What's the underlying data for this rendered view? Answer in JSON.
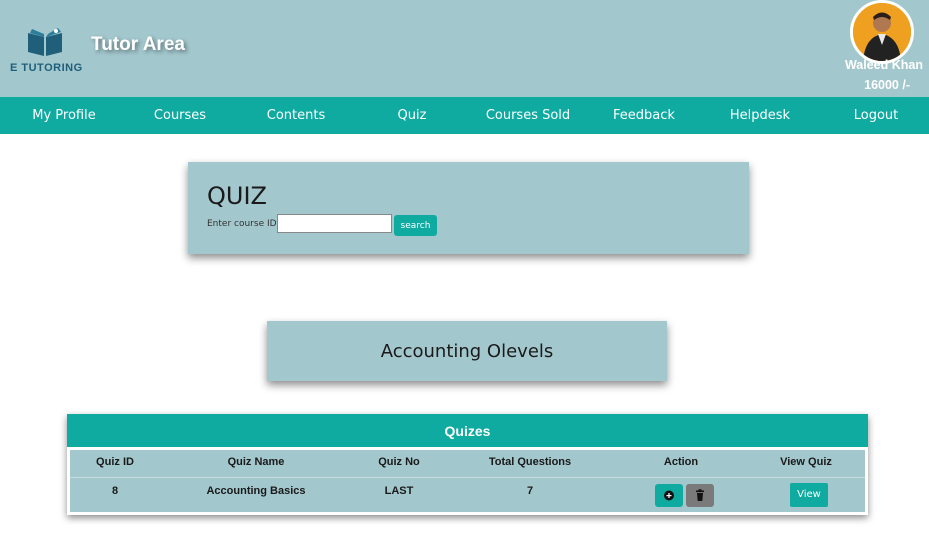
{
  "header": {
    "logo_text": "E TUTORING",
    "app_title": "Tutor Area",
    "user_name": "Waleed Khan",
    "user_balance": "16000 /-",
    "bg_color": "#a2c7cd"
  },
  "nav": {
    "bg_color": "#0faaa0",
    "items": [
      {
        "label": "My Profile"
      },
      {
        "label": "Courses"
      },
      {
        "label": "Contents"
      },
      {
        "label": "Quiz"
      },
      {
        "label": "Courses Sold"
      },
      {
        "label": "Feedback"
      },
      {
        "label": "Helpdesk"
      },
      {
        "label": "Logout"
      }
    ]
  },
  "quiz_search": {
    "title": "QUIZ",
    "label": "Enter course ID:",
    "input_value": "",
    "button_label": "search"
  },
  "course": {
    "name": "Accounting Olevels"
  },
  "quizzes_table": {
    "title": "Quizes",
    "columns": [
      "Quiz ID",
      "Quiz Name",
      "Quiz No",
      "Total Questions",
      "Action",
      "View Quiz"
    ],
    "rows": [
      {
        "quiz_id": "8",
        "quiz_name": "Accounting Basics",
        "quiz_no": "LAST",
        "total_questions": "7",
        "view_label": "View"
      }
    ],
    "icons": [
      "add-circle-icon",
      "trash-icon"
    ]
  }
}
